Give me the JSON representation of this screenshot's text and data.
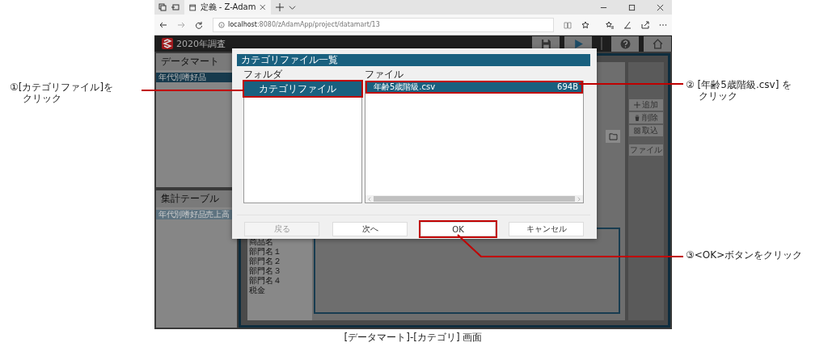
{
  "browser": {
    "tab_title": "定義 - Z-Adam",
    "url_host": "localhost",
    "url_path": ":8080/zAdamApp/project/datamart/13"
  },
  "app": {
    "title": "2020年調査"
  },
  "datamart": {
    "title": "データマート",
    "items": [
      {
        "label": "年代別嗜好品",
        "selected": true
      }
    ]
  },
  "aggregate": {
    "title": "集計テーブル",
    "items": [
      {
        "label": "年代別嗜好品売上高",
        "selected": true
      }
    ]
  },
  "fields": [
    "商品名",
    "部門名１",
    "部門名２",
    "部門名３",
    "部門名４",
    "税金"
  ],
  "side_buttons": [
    {
      "label": "追加",
      "kind": "plus"
    },
    {
      "label": "削除",
      "kind": "trash"
    },
    {
      "label": "取込",
      "kind": "grid"
    },
    {
      "label": "ファイル",
      "kind": "plain"
    }
  ],
  "dialog": {
    "title": "カテゴリファイル一覧",
    "folder_label": "フォルダ",
    "file_label": "ファイル",
    "folders": [
      {
        "name": "カテゴリファイル",
        "selected": true,
        "highlighted": true
      }
    ],
    "files": [
      {
        "name": "年齢5歳階級.csv",
        "size": "694B",
        "selected": true,
        "highlighted": true
      }
    ],
    "buttons": [
      {
        "label": "戻る",
        "disabled": true,
        "highlighted": false
      },
      {
        "label": "次へ",
        "disabled": false,
        "highlighted": false
      },
      {
        "label": "OK",
        "disabled": false,
        "highlighted": true
      },
      {
        "label": "キャンセル",
        "disabled": false,
        "highlighted": false
      }
    ]
  },
  "callouts": [
    {
      "lines": [
        "①[カテゴリファイル]を",
        "クリック"
      ]
    },
    {
      "lines": [
        "② [年齢5歳階級.csv] を",
        "クリック"
      ]
    },
    {
      "lines": [
        "③<OK>ボタンをクリック"
      ]
    }
  ],
  "caption": "[データマート]-[カテゴリ] 画面"
}
